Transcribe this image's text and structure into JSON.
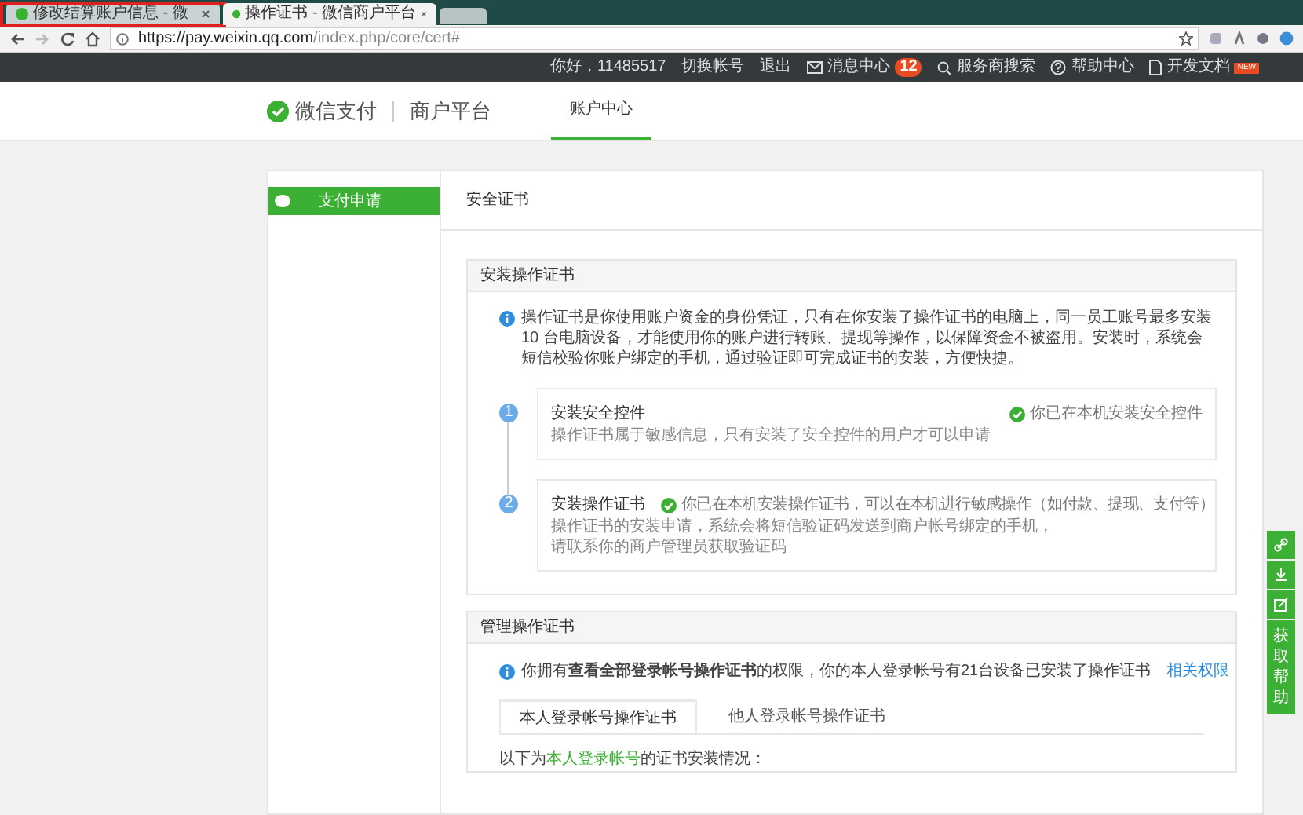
{
  "browser": {
    "tabs": [
      {
        "title": "修改结算账户信息 - 微",
        "selected": false,
        "highlighted": true
      },
      {
        "title": "操作证书 - 微信商户平台",
        "selected": true,
        "highlighted": false
      }
    ],
    "url_host": "https://pay.weixin.qq.com",
    "url_path": "/index.php/core/cert#"
  },
  "topbar": {
    "greeting": "你好，11485517",
    "links": [
      "切换帐号",
      "退出"
    ],
    "messages": {
      "label": "消息中心",
      "count": "12"
    },
    "search": "服务商搜索",
    "help": "帮助中心",
    "docs": {
      "label": "开发文档",
      "badge": "NEW"
    }
  },
  "header": {
    "brand": "微信支付",
    "platform": "商户平台",
    "nav": [
      {
        "label": "账户中心",
        "selected": true
      }
    ]
  },
  "sidebar": {
    "items": [
      {
        "label": "支付申请",
        "selected": true
      }
    ]
  },
  "page_title": "安全证书",
  "install_section": {
    "title": "安装操作证书",
    "notice": "操作证书是你使用账户资金的身份凭证，只有在你安装了操作证书的电脑上，同一员工账号最多安装 10 台电脑设备，才能使用你的账户进行转账、提现等操作，以保障资金不被盗用。安装时，系统会短信校验你账户绑定的手机，通过验证即可完成证书的安装，方便快捷。",
    "steps": [
      {
        "number": "1",
        "title": "安装安全控件",
        "status": "你已在本机安装安全控件",
        "done": true,
        "description": [
          "操作证书属于敏感信息，只有安装了安全控件的用户才可以申请"
        ]
      },
      {
        "number": "2",
        "title": "安装操作证书",
        "status": "你已在本机安装操作证书，可以在本机进行敏感操作（如付款、提现、支付等）",
        "done": true,
        "description": [
          "操作证书的安装申请，系统会将短信验证码发送到商户帐号绑定的手机，",
          "请联系你的商户管理员获取验证码"
        ]
      }
    ]
  },
  "manage_section": {
    "title": "管理操作证书",
    "notice": "你拥有**查看全部登录帐号操作证书**的权限，你的本人登录帐号有21台设备已安装了操作证书",
    "link": "相关权限",
    "tabs": [
      {
        "label": "本人登录帐号操作证书",
        "selected": true
      },
      {
        "label": "他人登录帐号操作证书",
        "selected": false
      }
    ],
    "summary_prefix": "以下为",
    "summary_highlight": "本人登录帐号",
    "summary_suffix": "的证书安装情况："
  },
  "float_toolbar": {
    "help": "获取帮助"
  }
}
